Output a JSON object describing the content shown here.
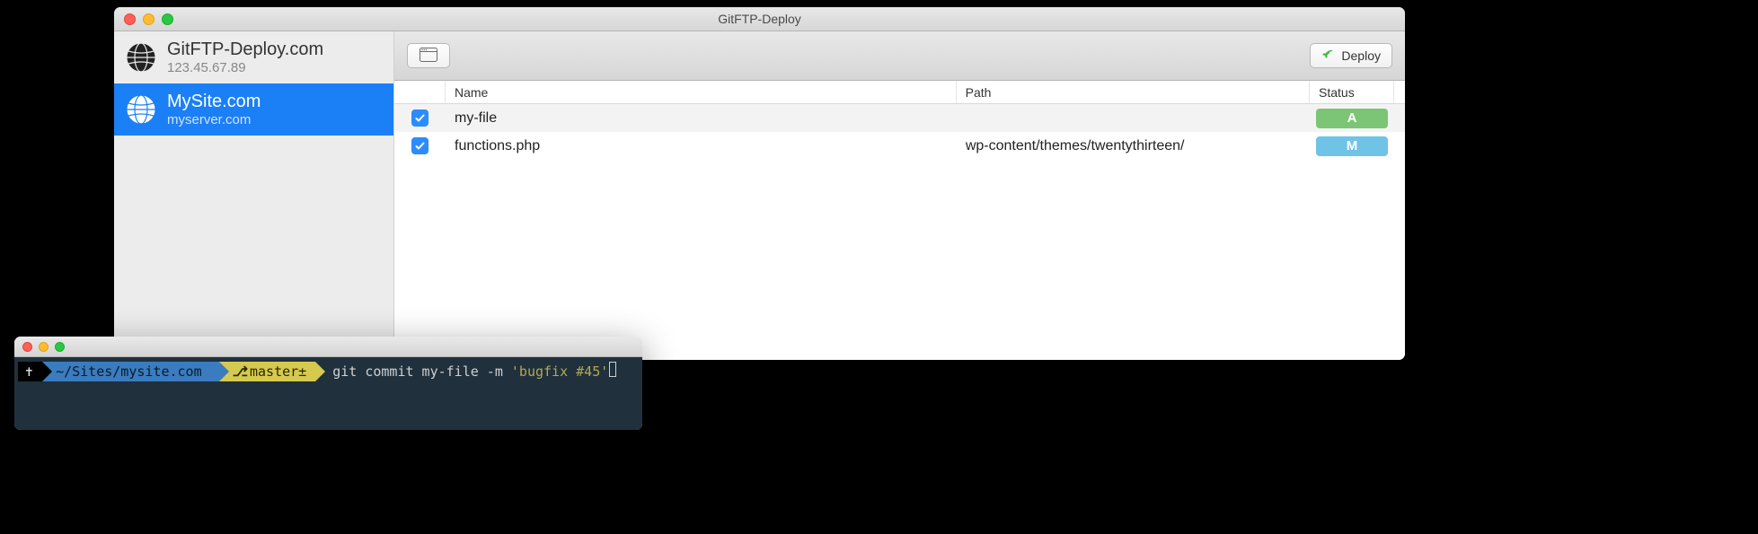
{
  "window": {
    "title": "GitFTP-Deploy"
  },
  "sidebar": {
    "items": [
      {
        "title": "GitFTP-Deploy.com",
        "subtitle": "123.45.67.89",
        "selected": false
      },
      {
        "title": "MySite.com",
        "subtitle": "myserver.com",
        "selected": true
      }
    ]
  },
  "toolbar": {
    "deploy_label": "Deploy"
  },
  "table": {
    "headers": {
      "name": "Name",
      "path": "Path",
      "status": "Status"
    },
    "rows": [
      {
        "checked": true,
        "name": "my-file",
        "path": "",
        "status": "A"
      },
      {
        "checked": true,
        "name": "functions.php",
        "path": "wp-content/themes/twentythirteen/",
        "status": "M"
      }
    ]
  },
  "terminal": {
    "cwd_icon": "✝",
    "cwd": "~/Sites/mysite.com",
    "branch_icon": "⎇",
    "branch": "master±",
    "command_prefix": "git commit my-file -m ",
    "command_string": "'bugfix #45'"
  },
  "colors": {
    "selection": "#1b7ff6",
    "status_A": "#7cc576",
    "status_M": "#6fc3e6"
  }
}
